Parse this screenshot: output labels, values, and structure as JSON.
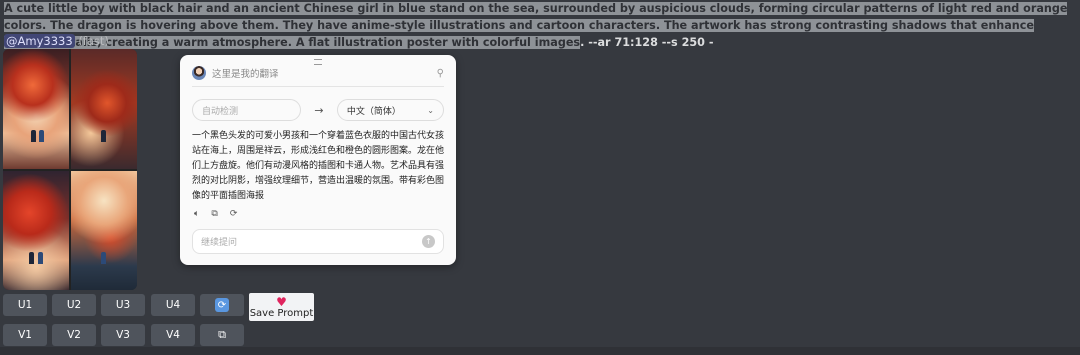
{
  "message": {
    "prompt_highlighted": "A cute little boy with black hair and an ancient Chinese girl in blue stand on the sea, surrounded by auspicious clouds, forming circular patterns of light red and orange colors. The dragon is hovering above them. They have anime-style illustrations and cartoon characters. The artwork has strong contrasting shadows that enhance texture details, creating a warm atmosphere. A flat illustration poster with colorful images",
    "prompt_params": ". --ar 71:128 --s 250 -",
    "mention": "@Amy3333",
    "speed": "(fast)"
  },
  "translator": {
    "title": "这里是我的翻译",
    "source_placeholder": "自动检测",
    "target_language": "中文（简体）",
    "translation_text": "一个黑色头发的可爱小男孩和一个穿着蓝色衣服的中国古代女孩站在海上，周围是祥云，形成浅红色和橙色的圆形图案。龙在他们上方盘旋。他们有动漫风格的插图和卡通人物。艺术品具有强烈的对比阴影，增强纹理细节，营造出温暖的氛围。带有彩色图像的平面插图海报",
    "followup_placeholder": "继续提问"
  },
  "buttons": {
    "u1": "U1",
    "u2": "U2",
    "u3": "U3",
    "u4": "U4",
    "v1": "V1",
    "v2": "V2",
    "v3": "V3",
    "v4": "V4",
    "save_prompt": "Save Prompt"
  },
  "icons": {
    "refresh": "refresh-icon",
    "open_external": "external-link-icon",
    "heart": "heart-icon"
  },
  "colors": {
    "background": "#36393f",
    "button": "#4f545c",
    "accent_blue": "#5a97e0",
    "heart": "#e0245e"
  }
}
